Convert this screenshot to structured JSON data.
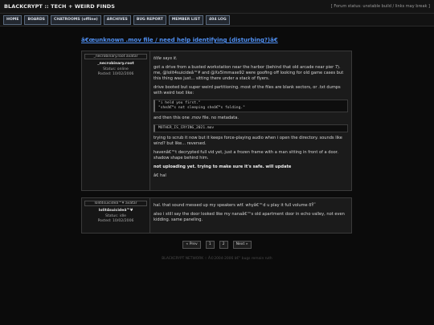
{
  "header": {
    "site_title": "BLACKCRYPT :: TECH + WEIRD FINDS",
    "status": "[ Forum status: unstable build / links may break ]"
  },
  "nav": [
    "HOME",
    "BOARDS",
    "CHATROOMS (offline)",
    "ARCHIVES",
    "BUG REPORT",
    "MEMBER LIST",
    "404 LOG"
  ],
  "thread": {
    "title": "â€œunknown .mov file / need help identifying (disturbing?)â€"
  },
  "posts": [
    {
      "avatar_alt": "_necrobinary.root avatar",
      "username": "_necrobinary.root",
      "status": "Status: online",
      "posted": "Posted: 10/02/2006",
      "body": {
        "p1": "title says it.",
        "p2": "got a drive from a busted workstation near the harbor (behind that old arcade near pier 7). me, @lolit4suicideâ™¥ and @Xx5lmmaxe92 were goofing off looking for old game cases but this thing was just... sitting there under a stack of flyers.",
        "p3": "drive booted but super weird partitioning. most of the files are blank sectors, or .txt dumps with weird text like:",
        "code1_line1": "\"i held you first.\"",
        "code1_line2": "\"sheâ€™s not sleeping sheâ€™s folding.\"",
        "p4": "and then this one .mov file. no metadata.",
        "code2": "MOTHER_IS_CRYING_2021.mov",
        "p5": "trying to scrub it now but it keeps force-playing audio when i open the directory. sounds like wind? but like... reversed.",
        "p6": "havenâ€™t decrypted full vid yet, just a frozen frame with a man sitting in front of a door. shadow shape behind him.",
        "p7": "not uploading yet. trying to make sure it's safe. will update",
        "p8": "â€ hal"
      }
    },
    {
      "avatar_alt": "lolit4suicideâ™¥ avatar",
      "username": "lolit4suicideâ™¥",
      "status": "Status: idle",
      "posted": "Posted: 10/02/2006",
      "body": {
        "p1": "hal. that sound messed up my speakers wtf. whyâ€™d u play it full volume ðŸ˜­",
        "p2": "also i still say the door looked like my nanaâ€™s old apartment door in echo valley, not even kidding. same paneling."
      }
    }
  ],
  "pagination": {
    "prev": "« Prev",
    "pages": [
      "1",
      "2"
    ],
    "next": "Next »"
  },
  "footer": "BLACKCRYPT NETWORK :: Â©2004-2006 â€“ bugs remain ruth",
  "colors": {
    "background": "#0b0b0b",
    "link": "#4f8ff2",
    "nav_border": "#5a6a7e"
  }
}
